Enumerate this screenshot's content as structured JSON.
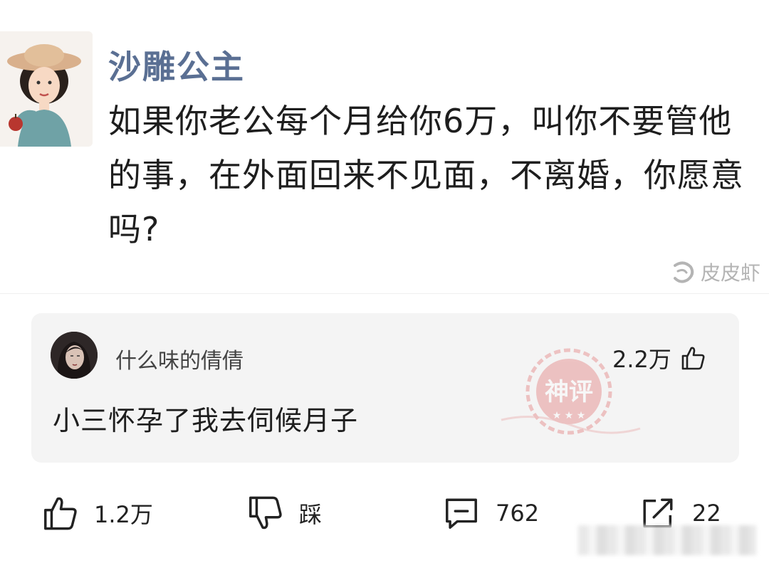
{
  "post": {
    "author": "沙雕公主",
    "text": "如果你老公每个月给你6万，叫你不要管他的事，在外面回来不见面，不离婚，你愿意吗?",
    "watermark_text": "皮皮虾"
  },
  "comment": {
    "username": "什么味的倩倩",
    "likes": "2.2万",
    "text": "小三怀孕了我去伺候月子",
    "stamp_text": "神评"
  },
  "actions": {
    "like_count": "1.2万",
    "dislike_label": "踩",
    "comment_count": "762",
    "share_count": "22"
  },
  "colors": {
    "author": "#5a6f93",
    "card_bg": "#f4f4f4",
    "stamp": "#e06464"
  }
}
